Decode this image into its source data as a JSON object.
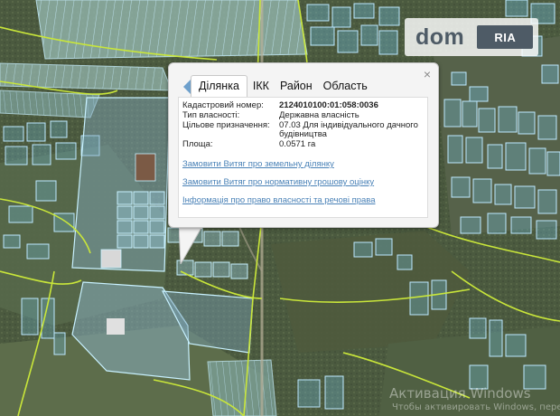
{
  "watermark": {
    "dom": "dom",
    "ria": "RIA"
  },
  "popup": {
    "tabs": [
      "Ділянка",
      "ІКК",
      "Район",
      "Область"
    ],
    "active_tab": "Ділянка",
    "close": "×",
    "fields": [
      {
        "label": "Кадастровий номер:",
        "value": "2124010100:01:058:0036"
      },
      {
        "label": "Тип власності:",
        "value": "Державна власність"
      },
      {
        "label": "Цільове призначення:",
        "value": "07.03 Для індивідуального дачного будівництва"
      },
      {
        "label": "Площа:",
        "value": "0.0571 га"
      }
    ],
    "links": [
      "Замовити Витяг про земельну ділянку",
      "Замовити Витяг про нормативну грошову оцінку",
      "Інформація про право власності та речові права"
    ]
  },
  "windows": {
    "line1": "Активация Windows",
    "line2": "Чтобы активировать Windows, пере"
  },
  "colors": {
    "parcel": "#74c6e8",
    "boundary": "#c9e63a",
    "link": "#4a82b7"
  }
}
